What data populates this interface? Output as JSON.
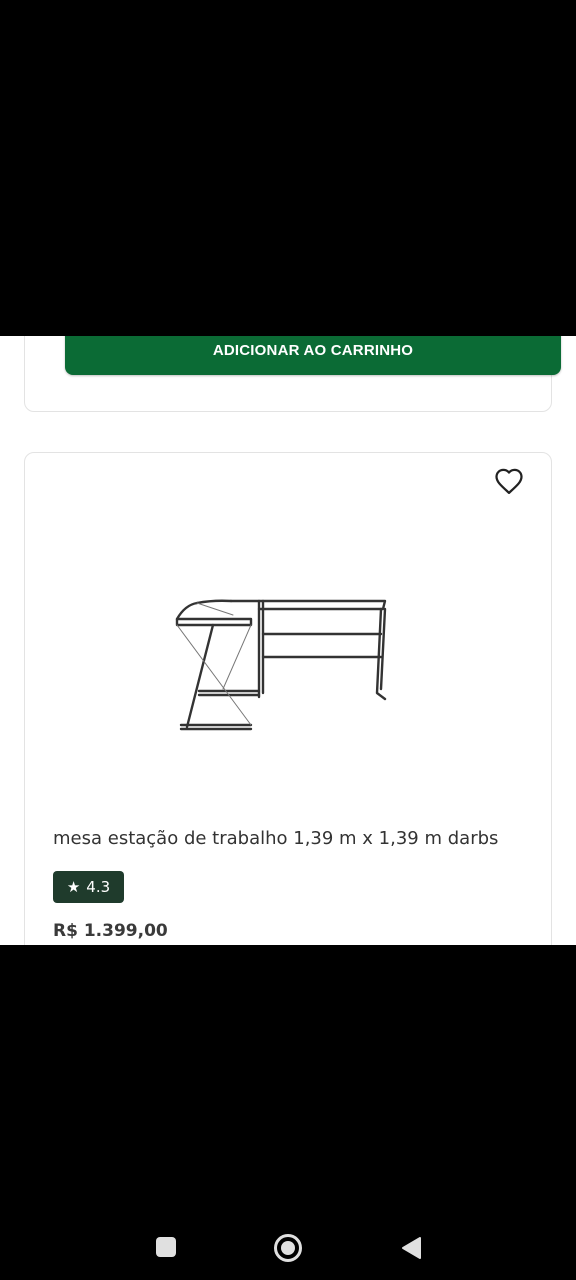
{
  "previous_card": {
    "add_to_cart_label": "ADICIONAR AO CARRINHO"
  },
  "product_card": {
    "title": "mesa estação de trabalho 1,39 m x 1,39 m darbs",
    "rating_star": "★",
    "rating_value": "4.3",
    "price": "R$ 1.399,00"
  },
  "colors": {
    "brand_green": "#0b6b35",
    "rating_badge": "#1f3b2c"
  },
  "icons": {
    "favorite": "heart-outline-icon",
    "nav_recents": "square-icon",
    "nav_home": "circle-icon",
    "nav_back": "triangle-back-icon"
  }
}
